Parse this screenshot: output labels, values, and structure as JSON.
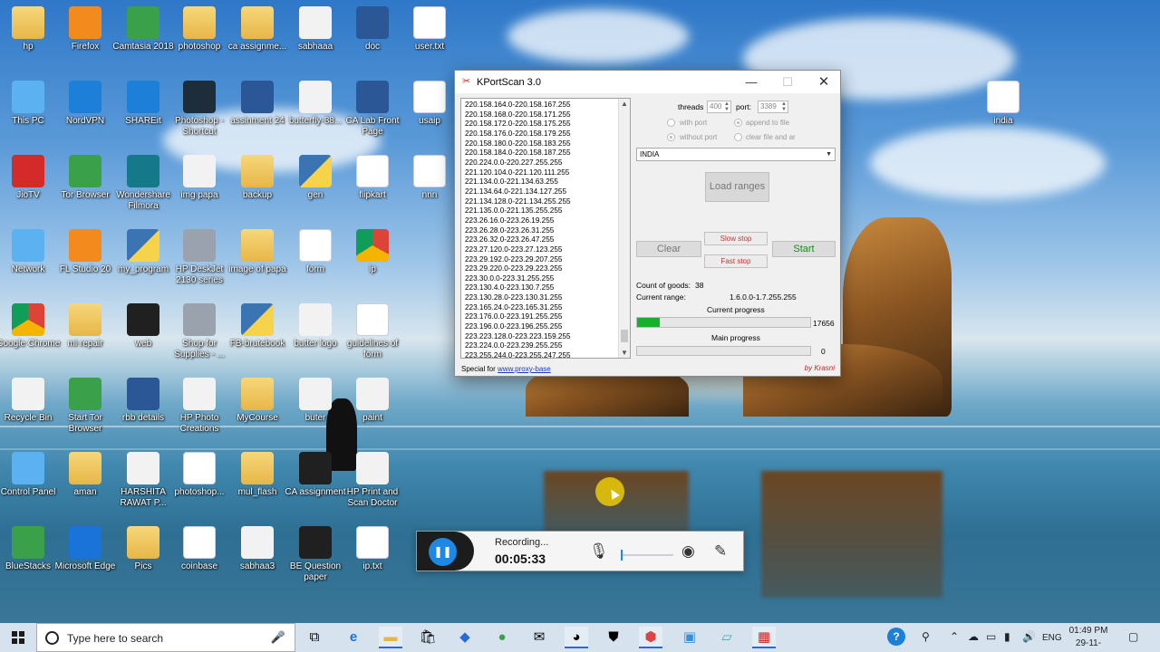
{
  "desktop": {
    "icons": [
      {
        "label": "hp",
        "icon": "user-folder-icon"
      },
      {
        "label": "Firefox",
        "icon": "firefox-icon"
      },
      {
        "label": "Camtasia 2018",
        "icon": "camtasia-icon"
      },
      {
        "label": "photoshop",
        "icon": "folder-icon"
      },
      {
        "label": "ca assignme...",
        "icon": "folder-icon"
      },
      {
        "label": "sabhaaa",
        "icon": "image-icon"
      },
      {
        "label": "doc",
        "icon": "word-icon"
      },
      {
        "label": "user.txt",
        "icon": "text-file-icon"
      },
      {
        "label": "This PC",
        "icon": "computer-icon"
      },
      {
        "label": "NordVPN",
        "icon": "nordvpn-icon"
      },
      {
        "label": "SHAREit",
        "icon": "shareit-icon"
      },
      {
        "label": "Photoshop - Shortcut",
        "icon": "photoshop-icon"
      },
      {
        "label": "assinment 24",
        "icon": "word-icon"
      },
      {
        "label": "butterfly-88...",
        "icon": "butterfly-image-icon"
      },
      {
        "label": "CA Lab Front Page",
        "icon": "word-icon"
      },
      {
        "label": "usaip",
        "icon": "text-file-icon"
      },
      {
        "label": "india",
        "icon": "text-file-icon"
      },
      {
        "label": "JioTV",
        "icon": "jiotv-icon"
      },
      {
        "label": "Tor Browser",
        "icon": "tor-browser-icon"
      },
      {
        "label": "Wondershare Filmora",
        "icon": "filmora-icon"
      },
      {
        "label": "img papa",
        "icon": "image-icon"
      },
      {
        "label": "backup",
        "icon": "folder-icon"
      },
      {
        "label": "gen",
        "icon": "python-file-icon"
      },
      {
        "label": "flipkart",
        "icon": "text-file-icon"
      },
      {
        "label": "nnn",
        "icon": "text-file-icon"
      },
      {
        "label": "Network",
        "icon": "network-icon"
      },
      {
        "label": "FL Studio 20",
        "icon": "fl-studio-icon"
      },
      {
        "label": "my_program",
        "icon": "python-file-icon"
      },
      {
        "label": "HP DeskJet 2130 series",
        "icon": "printer-icon"
      },
      {
        "label": "image of papa",
        "icon": "folder-icon"
      },
      {
        "label": "form",
        "icon": "pdf-icon"
      },
      {
        "label": "ip",
        "icon": "chrome-icon"
      },
      {
        "label": "Google Chrome",
        "icon": "chrome-icon"
      },
      {
        "label": "mi repair",
        "icon": "folder-icon"
      },
      {
        "label": "web",
        "icon": "winrar-icon"
      },
      {
        "label": "Shop for Supplies - ...",
        "icon": "printer-shop-icon"
      },
      {
        "label": "FB-brutebook",
        "icon": "python-file-icon"
      },
      {
        "label": "butter logo",
        "icon": "butterfly-image-icon"
      },
      {
        "label": "guidelines of form",
        "icon": "pdf-icon"
      },
      {
        "label": "Recycle Bin",
        "icon": "recycle-bin-icon"
      },
      {
        "label": "Start Tor Browser",
        "icon": "tor-browser-icon"
      },
      {
        "label": "rbb details",
        "icon": "word-icon"
      },
      {
        "label": "HP Photo Creations",
        "icon": "hp-photo-icon"
      },
      {
        "label": "MyCourse",
        "icon": "folder-icon"
      },
      {
        "label": "buter",
        "icon": "butterfly-image-icon"
      },
      {
        "label": "paint",
        "icon": "image-icon"
      },
      {
        "label": "Control Panel",
        "icon": "control-panel-icon"
      },
      {
        "label": "aman",
        "icon": "folder-icon"
      },
      {
        "label": "HARSHITA RAWAT P...",
        "icon": "powerpoint-icon"
      },
      {
        "label": "photoshop...",
        "icon": "text-file-icon"
      },
      {
        "label": "mul_flash",
        "icon": "folder-icon"
      },
      {
        "label": "CA assignment",
        "icon": "winrar-icon"
      },
      {
        "label": "HP Print and Scan Doctor",
        "icon": "hp-icon"
      },
      {
        "label": "BlueStacks",
        "icon": "bluestacks-icon"
      },
      {
        "label": "Microsoft Edge",
        "icon": "edge-icon"
      },
      {
        "label": "Pics",
        "icon": "folder-icon"
      },
      {
        "label": "coinbase",
        "icon": "text-file-icon"
      },
      {
        "label": "sabhaa3",
        "icon": "image-icon"
      },
      {
        "label": "BE Question paper",
        "icon": "winrar-icon"
      },
      {
        "label": "ip.txt",
        "icon": "text-file-icon"
      }
    ]
  },
  "app": {
    "title": "KPortScan 3.0",
    "ranges": [
      "220.158.164.0-220.158.167.255",
      "220.158.168.0-220.158.171.255",
      "220.158.172.0-220.158.175.255",
      "220.158.176.0-220.158.179.255",
      "220.158.180.0-220.158.183.255",
      "220.158.184.0-220.158.187.255",
      "220.224.0.0-220.227.255.255",
      "221.120.104.0-221.120.111.255",
      "221.134.0.0-221.134.63.255",
      "221.134.64.0-221.134.127.255",
      "221.134.128.0-221.134.255.255",
      "221.135.0.0-221.135.255.255",
      "223.26.16.0-223.26.19.255",
      "223.26.28.0-223.26.31.255",
      "223.26.32.0-223.26.47.255",
      "223.27.120.0-223.27.123.255",
      "223.29.192.0-223.29.207.255",
      "223.29.220.0-223.29.223.255",
      "223.30.0.0-223.31.255.255",
      "223.130.4.0-223.130.7.255",
      "223.130.28.0-223.130.31.255",
      "223.165.24.0-223.165.31.255",
      "223.176.0.0-223.191.255.255",
      "223.196.0.0-223.196.255.255",
      "223.223.128.0-223.223.159.255",
      "223.224.0.0-223.239.255.255",
      "223.255.244.0-223.255.247.255"
    ],
    "threads_label": "threads",
    "threads_value": "400",
    "port_label": "port:",
    "port_value": "3389",
    "radio_with_port": "with port",
    "radio_without_port": "without port",
    "radio_append": "append to file",
    "radio_clear_file": "clear file and ar",
    "country": "INDIA",
    "load_ranges": "Load ranges",
    "clear": "Clear",
    "slow_stop": "Slow stop",
    "fast_stop": "Fast stop",
    "start": "Start",
    "count_label": "Count of goods:",
    "count_value": "38",
    "current_range_label": "Current range:",
    "current_range_value": "1.6.0.0-1.7.255.255",
    "current_progress_label": "Current progress",
    "current_progress_value": "17656",
    "current_progress_fraction": 0.13,
    "main_progress_label": "Main progress",
    "main_progress_value": "0",
    "main_progress_fraction": 0,
    "special_for": "Special for",
    "special_link": "www.proxy-base",
    "by": "by Krasni"
  },
  "recorder": {
    "status": "Recording...",
    "time": "00:05:33"
  },
  "taskbar": {
    "search_placeholder": "Type here to search",
    "language": "ENG",
    "time": "01:49 PM",
    "date": "29-11-2018"
  },
  "colors": {
    "accent": "#1e88e5",
    "progress_fill": "#16b02a",
    "stop_text": "#cc3333",
    "start_text": "#1a8a1a"
  }
}
